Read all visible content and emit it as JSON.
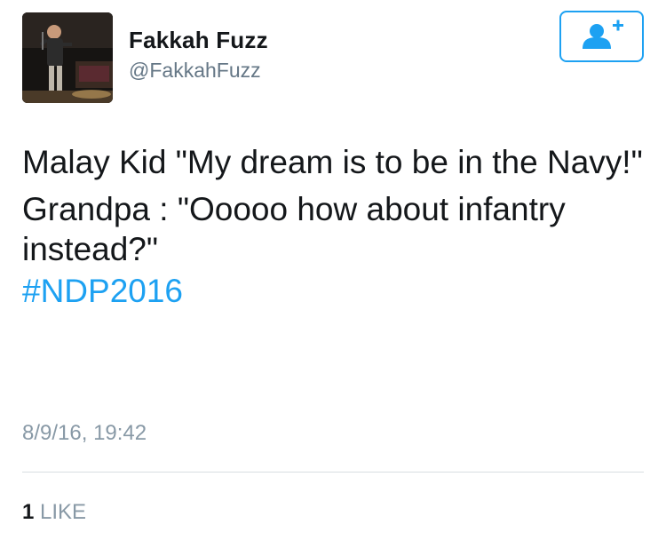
{
  "user": {
    "display_name": "Fakkah Fuzz",
    "handle": "@FakkahFuzz",
    "avatar_icon": "profile-photo"
  },
  "follow_button": {
    "icon": "add-user-icon",
    "color": "#1da1f2"
  },
  "tweet": {
    "paragraph1": "Malay Kid \"My dream is to be in the Navy!\"",
    "paragraph2": "Grandpa : \"Ooooo how about infantry instead?\"",
    "hashtag": "#NDP2016",
    "timestamp": "8/9/16, 19:42"
  },
  "stats": {
    "like_count": "1",
    "like_label": "LIKE"
  },
  "colors": {
    "accent": "#1da1f2",
    "muted": "#8899a6"
  }
}
